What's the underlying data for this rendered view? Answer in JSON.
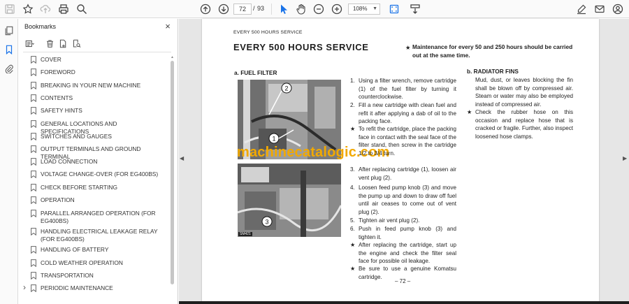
{
  "toolbar": {
    "page_current": "72",
    "page_separator": "/",
    "page_total": "93",
    "zoom": "108%",
    "icons": [
      "save-icon",
      "bookmark-star-icon",
      "upload-icon",
      "print-icon",
      "search-icon",
      "page-up-icon",
      "page-down-icon",
      "select-cursor-icon",
      "hand-pan-icon",
      "zoom-out-icon",
      "zoom-in-icon",
      "fit-page-icon",
      "scroll-mode-icon",
      "sign-icon",
      "email-icon",
      "account-icon"
    ]
  },
  "sidebar": {
    "title": "Bookmarks",
    "close_label": "×",
    "items": [
      {
        "label": "COVER"
      },
      {
        "label": "FOREWORD"
      },
      {
        "label": "BREAKING IN YOUR NEW MACHINE"
      },
      {
        "label": "CONTENTS"
      },
      {
        "label": "SAFETY HINTS"
      },
      {
        "label": "GENERAL LOCATIONS AND SPECIFICATIONS"
      },
      {
        "label": "SWITCHES AND GAUGES"
      },
      {
        "label": "OUTPUT TERMINALS AND GROUND TERMINAL"
      },
      {
        "label": "LOAD CONNECTION"
      },
      {
        "label": "VOLTAGE CHANGE-OVER (FOR EG400BS)"
      },
      {
        "label": "CHECK BEFORE STARTING"
      },
      {
        "label": "OPERATION"
      },
      {
        "label": "PARALLEL ARRANGED OPERATION (FOR EG400BS)"
      },
      {
        "label": "HANDLING ELECTRICAL LEAKAGE RELAY (FOR EG400BS)"
      },
      {
        "label": "HANDLING OF BATTERY"
      },
      {
        "label": "COLD WEATHER OPERATION"
      },
      {
        "label": "TRANSPORTATION"
      },
      {
        "label": "PERIODIC MAINTENANCE",
        "expandable": true
      }
    ]
  },
  "document": {
    "header_small": "EVERY 500 HOURS SERVICE",
    "header_big": "EVERY 500 HOURS SERVICE",
    "note_star": "★",
    "note": "Maintenance for every 50 and 250 hours should be carried out at the same time.",
    "section_a": "a. FUEL FILTER",
    "section_b": "b. RADIATOR FINS",
    "photo_labels": [
      "2",
      "1",
      "3"
    ],
    "photo_tag": "SM421",
    "watermark": "machinecatalogic.com",
    "steps": [
      {
        "mark": "1.",
        "text": "Using a filter wrench, remove cartridge (1) of the fuel filter by turning it counterclockwise."
      },
      {
        "mark": "2.",
        "text": "Fill a new cartridge with clean fuel and refit it after applying a dab of oil to the packing face."
      },
      {
        "mark": "★",
        "text": "To refit the cartridge, place the packing face in contact with the seal face of the filter stand, then screw in the cartridge 1/2 to 3/4 turn."
      },
      {
        "mark": "3.",
        "text": "After replacing cartridge (1), loosen air vent plug (2)."
      },
      {
        "mark": "4.",
        "text": "Loosen feed pump knob (3) and move the pump up and down to draw off fuel until air ceases to come out of vent plug (2)."
      },
      {
        "mark": "5.",
        "text": "Tighten air vent plug (2)."
      },
      {
        "mark": "6.",
        "text": "Push in feed pump knob (3) and tighten it."
      },
      {
        "mark": "★",
        "text": "After replacing the cartridge, start up the engine and check the filter seal face for possible oil leakage."
      },
      {
        "mark": "★",
        "text": "Be sure to use a genuine Komatsu cartridge."
      }
    ],
    "radiator_text": "Mud, dust, or leaves blocking the fin shall be blown off by compressed air. Steam or water may also be employed instead of compressed air.",
    "radiator_star": "★",
    "radiator_note": "Check the rubber hose on this occasion and replace hose that is cracked or fragile. Further, also inspect loosened hose clamps.",
    "page_number": "– 72 –"
  },
  "colors": {
    "accent": "#1a73e8",
    "watermark": "#f2a900",
    "viewer_bg": "#e6e6e6"
  }
}
